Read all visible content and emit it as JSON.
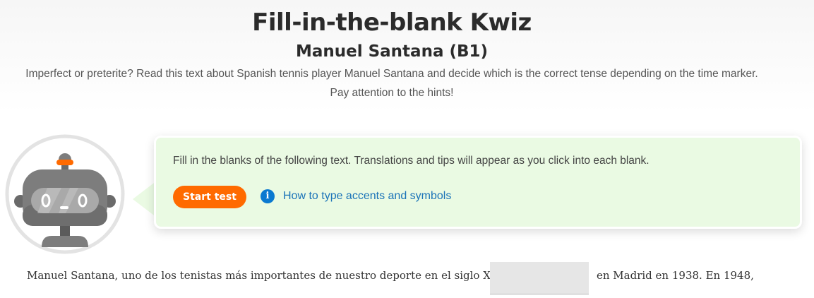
{
  "header": {
    "title": "Fill-in-the-blank Kwiz",
    "subtitle": "Manuel Santana (B1)",
    "intro": "Imperfect or preterite? Read this text about Spanish tennis player Manuel Santana and decide which is the correct tense depending on the time marker. Pay attention to the hints!"
  },
  "mascot": {
    "icon": "robot-mascot-icon",
    "colors": {
      "body": "#7d7d7d",
      "dark": "#5b5b5b",
      "antenna_band": "#ff6a00",
      "screen": "#a9a9a9",
      "ring": "#e3e3e3"
    }
  },
  "card": {
    "instruction": "Fill in the blanks of the following text. Translations and tips will appear as you click into each blank.",
    "start_label": "Start test",
    "accents_icon": "info-icon",
    "accents_label": "How to type accents and symbols",
    "colors": {
      "background": "#eafae3",
      "button": "#ff6a00",
      "link": "#1a73b8",
      "icon": "#0b79d0"
    }
  },
  "exercise": {
    "sentence_before": "Manuel Santana, uno de los tenistas más importantes de nuestro deporte en el siglo XX,",
    "blank_value": "",
    "sentence_after": "en Madrid en 1938.  En 1948,"
  }
}
